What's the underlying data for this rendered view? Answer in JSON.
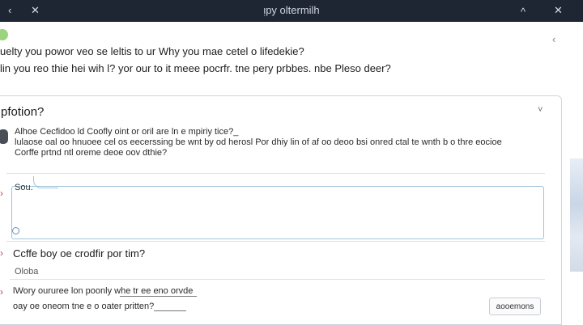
{
  "titlebar": {
    "title": "ᴉpy oltermilh",
    "back": "‹",
    "close": "✕",
    "up": "^"
  },
  "intro": {
    "line1": "uelty you powor veo se leltis to ur Why you mae cetel o lifedekie?",
    "line2": "lin you reo thie hei wih l? yor our to it meee pocrfr. tne pery prbbes. nbe Pleso deer?"
  },
  "panel": {
    "title": "pfotion?",
    "collapse": "˅",
    "lines": [
      "Alhoe Cecfidoo ld Coofly oint or oril are ln e mpiriy tice?_",
      "lulaose oal oo hnuoee cel os eecerssing be wnt by od herosl Por dhiy lin of af oo deoo bsi onred ctal te wnth b o thre eocioe",
      "Corffe prtnd ntl oreme deoe oov dthie?"
    ]
  },
  "answer": {
    "label": "Sou."
  },
  "section": {
    "title": "Ccffe boy oe crodfir por tim?",
    "sub": "Oloba"
  },
  "bottom": {
    "line1": "lWory oururee lon poonly whe tr ee eno orvde",
    "line2": "oay oe oneom tne e o oater pritten?"
  },
  "submit": {
    "label": "aooemons"
  }
}
